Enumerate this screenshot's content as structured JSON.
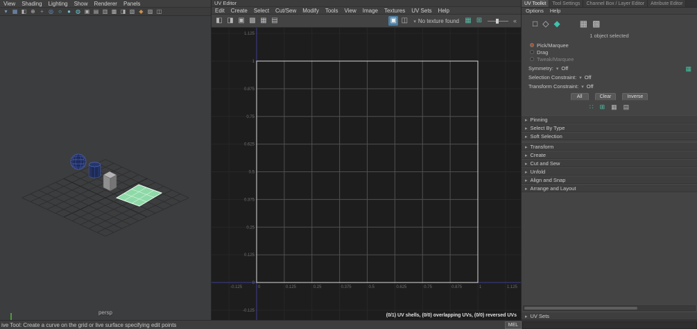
{
  "viewport": {
    "menus": [
      {
        "label": "View",
        "name": "menu-view"
      },
      {
        "label": "Shading",
        "name": "menu-shading"
      },
      {
        "label": "Lighting",
        "name": "menu-lighting"
      },
      {
        "label": "Show",
        "name": "menu-show"
      },
      {
        "label": "Renderer",
        "name": "menu-renderer"
      },
      {
        "label": "Panels",
        "name": "menu-panels"
      }
    ],
    "toolbar_icons": [
      {
        "name": "selection-mask-icon",
        "glyph": "▾",
        "style": "color:#7a9cc8"
      },
      {
        "name": "snap-to-grid-icon",
        "glyph": "▦",
        "style": "color:#7a9cc8"
      },
      {
        "name": "snap-to-curve-icon",
        "glyph": "◧"
      },
      {
        "name": "snap-to-point-icon",
        "glyph": "⊕"
      },
      {
        "name": "snap-to-view-plane-icon",
        "glyph": "+",
        "style": "color:#6a9bd8"
      },
      {
        "name": "make-live-icon",
        "glyph": "◎",
        "style": "color:#6a9bd8"
      },
      {
        "name": "wireframe-display-icon",
        "glyph": "○",
        "style": "color:#66c6d8"
      },
      {
        "name": "smooth-shade-display-icon",
        "glyph": "●",
        "style": "color:#66c6d8"
      },
      {
        "name": "textured-display-icon",
        "glyph": "◍",
        "style": "color:#66c6d8"
      },
      {
        "name": "lighting-display-icon",
        "glyph": "▣"
      },
      {
        "name": "shadow-display-icon",
        "glyph": "▤"
      },
      {
        "name": "screen-ao-display-icon",
        "glyph": "▥"
      },
      {
        "name": "motion-blur-display-icon",
        "glyph": "▩"
      },
      {
        "name": "camera-settings-icon",
        "glyph": "◨"
      },
      {
        "name": "gate-mask-icon",
        "glyph": "▧"
      },
      {
        "name": "field-chart-icon",
        "glyph": "◆",
        "style": "color:#c9914e"
      },
      {
        "name": "isolate-select-icon",
        "glyph": "▨"
      },
      {
        "name": "xray-display-icon",
        "glyph": "◫"
      }
    ],
    "camera_label": "persp"
  },
  "uv_editor": {
    "title": "UV Editor",
    "menus": [
      {
        "label": "Edit",
        "name": "menu-edit"
      },
      {
        "label": "Create",
        "name": "menu-create"
      },
      {
        "label": "Select",
        "name": "menu-select"
      },
      {
        "label": "Cut/Sew",
        "name": "menu-cut-sew"
      },
      {
        "label": "Modify",
        "name": "menu-modify"
      },
      {
        "label": "Tools",
        "name": "menu-tools"
      },
      {
        "label": "View",
        "name": "menu-uv-view"
      },
      {
        "label": "Image",
        "name": "menu-image"
      },
      {
        "label": "Textures",
        "name": "menu-textures"
      },
      {
        "label": "UV Sets",
        "name": "menu-uv-sets"
      },
      {
        "label": "Help",
        "name": "menu-uv-help"
      }
    ],
    "toolbar_icons_left": [
      {
        "name": "uv-transform-icon",
        "glyph": "◧"
      },
      {
        "name": "uv-flip-icon",
        "glyph": "◨"
      },
      {
        "name": "uv-rotate-icon",
        "glyph": "▣"
      },
      {
        "name": "uv-cut-icon",
        "glyph": "▩"
      },
      {
        "name": "uv-sew-icon",
        "glyph": "▦"
      },
      {
        "name": "uv-unfold-icon",
        "glyph": "▤"
      }
    ],
    "toolbar_icons_mid": [
      {
        "name": "display-image-icon",
        "glyph": "▣",
        "cls": "active"
      },
      {
        "name": "display-filtered-icon",
        "glyph": "◫"
      }
    ],
    "toolbar": {
      "no_texture": "No texture found"
    },
    "toolbar_icons_right": [
      {
        "name": "uv-texture-tiles-icon",
        "glyph": "▦",
        "style": "color:#55b9a5"
      },
      {
        "name": "pixel-snap-icon",
        "glyph": "⊞",
        "style": "color:#55b9a5"
      }
    ],
    "axis": {
      "u_labels": [
        "-0.125",
        "0",
        "0.125",
        "0.25",
        "0.375",
        "0.5",
        "0.625",
        "0.75",
        "0.875",
        "1",
        "1.125"
      ],
      "v_labels": [
        "1.125",
        "1",
        "0.875",
        "0.75",
        "0.625",
        "0.5",
        "0.375",
        "0.25",
        "0.125",
        "0",
        "-0.125"
      ]
    },
    "status": "(0/1) UV shells, (0/0) overlapping UVs, (0/0) reversed UVs"
  },
  "toolkit": {
    "tabs": [
      {
        "label": "UV Toolkit",
        "name": "tab-uv-toolkit",
        "cls": "active"
      },
      {
        "label": "Tool Settings",
        "name": "tab-tool-settings"
      },
      {
        "label": "Channel Box / Layer Editor",
        "name": "tab-channel-box-layer-editor"
      },
      {
        "label": "Attribute Editor",
        "name": "tab-attribute-editor"
      }
    ],
    "menus": [
      {
        "label": "Options",
        "name": "menu-options"
      },
      {
        "label": "Help",
        "name": "menu-toolkit-help"
      }
    ],
    "tool_icons": [
      {
        "name": "marquee-select-tool-icon",
        "glyph": "□"
      },
      {
        "name": "lasso-select-tool-icon",
        "glyph": "◇"
      },
      {
        "name": "uv-shell-tool-icon",
        "glyph": "◆",
        "style": "color:#3fc2ae"
      }
    ],
    "view_icons": [
      {
        "name": "texture-display-toggle-icon",
        "glyph": "▦"
      },
      {
        "name": "grid-display-toggle-icon",
        "glyph": "▩"
      }
    ],
    "selected_info": "1 object selected",
    "modes": [
      {
        "label": "Pick/Marquee",
        "name": "radio-pick-marquee",
        "cls": "selected"
      },
      {
        "label": "Drag",
        "name": "radio-drag"
      },
      {
        "label": "Tweak/Marquee",
        "name": "radio-tweak-marquee",
        "cls": "disabled"
      }
    ],
    "symmetry": {
      "label": "Symmetry:",
      "value": "Off"
    },
    "selection_constraint": {
      "label": "Selection Constraint:",
      "value": "Off"
    },
    "transform_constraint": {
      "label": "Transform Constraint:",
      "value": "Off"
    },
    "buttons": [
      {
        "label": "All",
        "name": "all-button"
      },
      {
        "label": "Clear",
        "name": "clear-button"
      },
      {
        "label": "Inverse",
        "name": "inverse-button"
      }
    ],
    "mini_icons": [
      {
        "name": "select-shortest-path-icon",
        "glyph": "∷",
        "style": "color:#4cc3a8"
      },
      {
        "name": "select-shell-icon",
        "glyph": "⊞",
        "style": "color:#4cc3a8"
      },
      {
        "name": "grow-selection-icon",
        "glyph": "▦"
      },
      {
        "name": "shrink-selection-icon",
        "glyph": "▤"
      }
    ],
    "sections_top": [
      {
        "label": "Pinning",
        "name": "section-pinning"
      },
      {
        "label": "Select By Type",
        "name": "section-select-by-type"
      },
      {
        "label": "Soft Selection",
        "name": "section-soft-selection"
      }
    ],
    "sections_main": [
      {
        "label": "Transform",
        "name": "section-transform"
      },
      {
        "label": "Create",
        "name": "section-create"
      },
      {
        "label": "Cut and Sew",
        "name": "section-cut-and-sew"
      },
      {
        "label": "Unfold",
        "name": "section-unfold"
      },
      {
        "label": "Align and Snap",
        "name": "section-align-and-snap"
      },
      {
        "label": "Arrange and Layout",
        "name": "section-arrange-and-layout"
      }
    ],
    "uv_sets": {
      "label": "UV Sets"
    }
  },
  "status_bar": {
    "help": "ive Tool: Create a curve on the grid or live surface specifying edit points",
    "mel": "MEL"
  }
}
